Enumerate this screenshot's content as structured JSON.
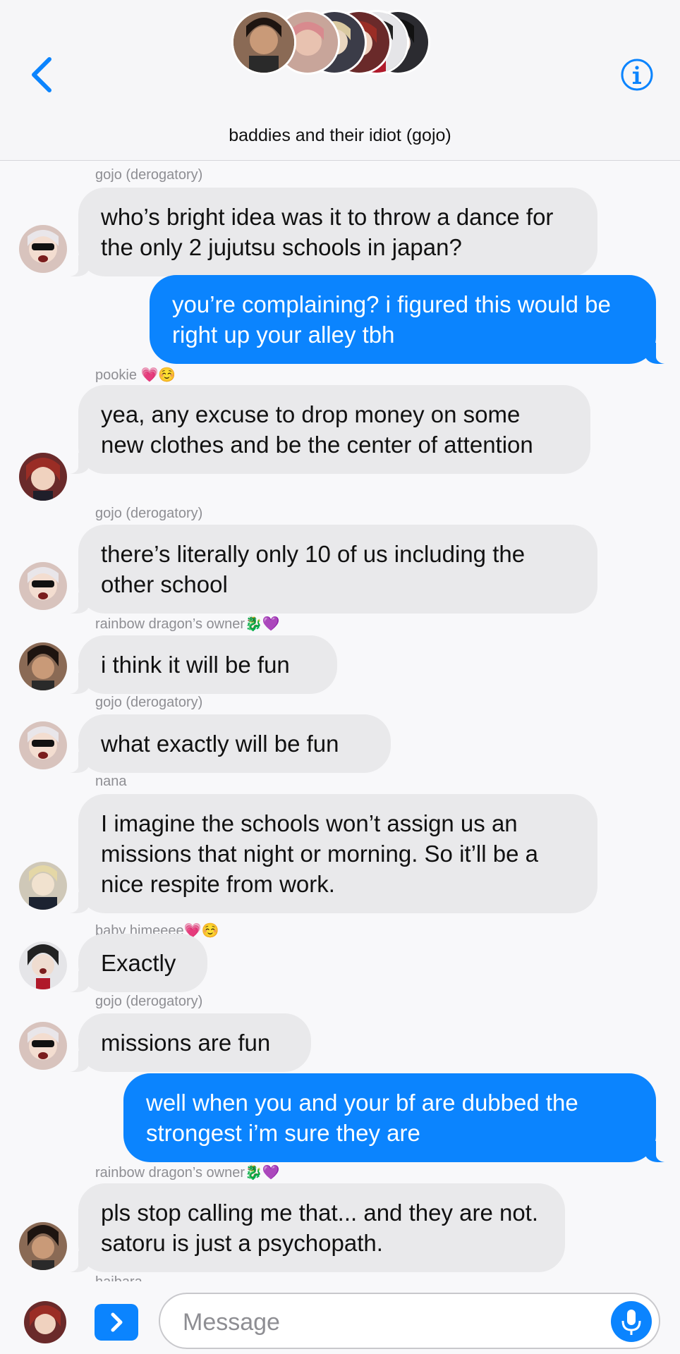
{
  "header": {
    "title": "baddies and their idiot (gojo)",
    "back_icon": "chevron-left-icon",
    "info_icon": "info-icon",
    "avatar_count": 6
  },
  "messages": [
    {
      "sender": "gojo (derogatory)",
      "text": "who’s bright idea was it to throw a dance for the only 2 jujutsu schools in japan?",
      "direction": "incoming"
    },
    {
      "sender": "",
      "text": "you’re complaining? i figured this would be right up your alley tbh",
      "direction": "outgoing"
    },
    {
      "sender": "pookie 💗☺️",
      "text": "yea, any excuse to drop money on some new clothes and be the center of attention",
      "direction": "incoming"
    },
    {
      "sender": "gojo (derogatory)",
      "text": "there’s literally only 10 of us including the other school",
      "direction": "incoming"
    },
    {
      "sender": "rainbow dragon’s owner🐉💜",
      "text": "i think it will be fun",
      "direction": "incoming"
    },
    {
      "sender": "gojo (derogatory)",
      "text": "what exactly will be fun",
      "direction": "incoming"
    },
    {
      "sender": "nana",
      "text": "I imagine the schools won’t assign us an missions that night or morning. So it’ll be a nice respite from work.",
      "direction": "incoming"
    },
    {
      "sender": "baby himeeee💗☺️",
      "text": "Exactly",
      "direction": "incoming"
    },
    {
      "sender": "gojo (derogatory)",
      "text": "missions are fun",
      "direction": "incoming"
    },
    {
      "sender": "",
      "text": "well when you and your bf are dubbed the strongest i’m sure they are",
      "direction": "outgoing"
    },
    {
      "sender": "rainbow dragon’s owner🐉💜",
      "text": "pls stop calling me that... and they are not. satoru is just a psychopath.",
      "direction": "incoming"
    },
    {
      "sender": "haibara",
      "text": "",
      "direction": "incoming"
    }
  ],
  "composer": {
    "placeholder": "Message",
    "apps_icon": "chevron-right-icon",
    "mic_icon": "microphone-icon"
  },
  "colors": {
    "accent": "#0b84fe",
    "incoming_bubble": "#e9e9eb",
    "background": "#f8f8fa",
    "sender_label": "#8e8e93"
  }
}
